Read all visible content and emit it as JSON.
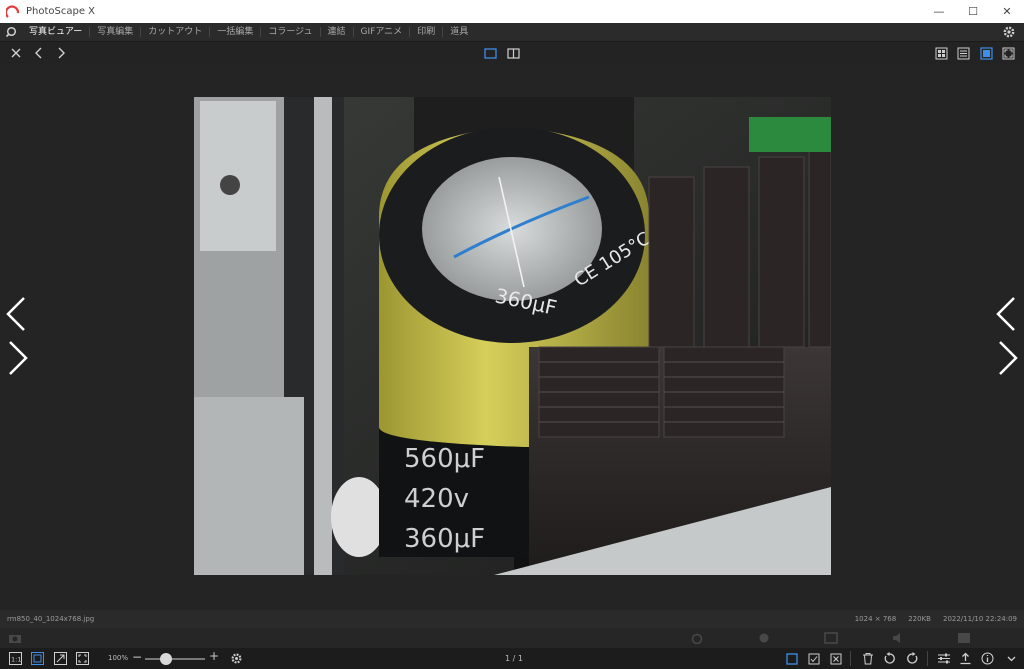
{
  "app": {
    "title": "PhotoScape X"
  },
  "window_controls": {
    "minimize": "—",
    "maximize": "☐",
    "close": "✕"
  },
  "menu": {
    "tabs": [
      {
        "label": "写真ビュアー",
        "active": true
      },
      {
        "label": "写真編集"
      },
      {
        "label": "カットアウト"
      },
      {
        "label": "一括編集"
      },
      {
        "label": "コラージュ"
      },
      {
        "label": "連結"
      },
      {
        "label": "GIFアニメ"
      },
      {
        "label": "印刷"
      },
      {
        "label": "道具"
      }
    ]
  },
  "status": {
    "filename": "rm850_40_1024x768.jpg",
    "dimensions": "1024 × 768",
    "filesize": "220KB",
    "datetime": "2022/11/10 22:24:09"
  },
  "bottom": {
    "zoom": "100%",
    "zoom_minus": "−",
    "zoom_plus": "+",
    "zoom_level": 0.35,
    "page": "1 / 1"
  },
  "colors": {
    "accent": "#3f8ee8",
    "capacitor_yellow": "#c9c24a",
    "heatsink": "#2a2626"
  }
}
